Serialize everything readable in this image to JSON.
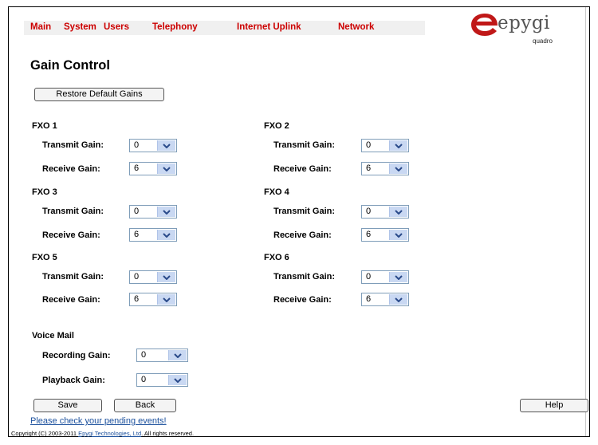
{
  "nav": {
    "items": [
      "Main",
      "System",
      "Users",
      "Telephony",
      "Internet Uplink",
      "Network"
    ]
  },
  "logo": {
    "brand": "epygi",
    "sub": "quadro"
  },
  "page": {
    "title": "Gain Control",
    "restore_label": "Restore Default Gains"
  },
  "groups": [
    {
      "name": "FXO 1",
      "transmit_label": "Transmit Gain:",
      "transmit_value": "0",
      "receive_label": "Receive Gain:",
      "receive_value": "6"
    },
    {
      "name": "FXO 2",
      "transmit_label": "Transmit Gain:",
      "transmit_value": "0",
      "receive_label": "Receive Gain:",
      "receive_value": "6"
    },
    {
      "name": "FXO 3",
      "transmit_label": "Transmit Gain:",
      "transmit_value": "0",
      "receive_label": "Receive Gain:",
      "receive_value": "6"
    },
    {
      "name": "FXO 4",
      "transmit_label": "Transmit Gain:",
      "transmit_value": "0",
      "receive_label": "Receive Gain:",
      "receive_value": "6"
    },
    {
      "name": "FXO 5",
      "transmit_label": "Transmit Gain:",
      "transmit_value": "0",
      "receive_label": "Receive Gain:",
      "receive_value": "6"
    },
    {
      "name": "FXO 6",
      "transmit_label": "Transmit Gain:",
      "transmit_value": "0",
      "receive_label": "Receive Gain:",
      "receive_value": "6"
    }
  ],
  "voicemail": {
    "name": "Voice Mail",
    "recording_label": "Recording Gain:",
    "recording_value": "0",
    "playback_label": "Playback Gain:",
    "playback_value": "0"
  },
  "footer": {
    "save_label": "Save",
    "back_label": "Back",
    "help_label": "Help",
    "pending_link": "Please check your pending events!",
    "copyright_prefix": "Copyright (C) 2003-2011 ",
    "copyright_company": "Epygi Technologies, Ltd",
    "copyright_suffix": ". All rights reserved."
  }
}
